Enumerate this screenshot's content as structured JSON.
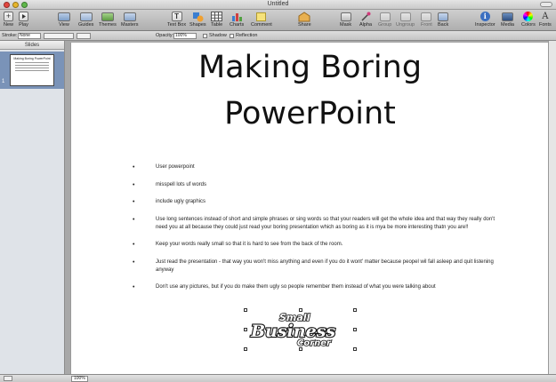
{
  "window": {
    "title": "Untitled"
  },
  "toolbar": {
    "new": "New",
    "play": "Play",
    "view": "View",
    "guides": "Guides",
    "themes": "Themes",
    "masters": "Masters",
    "text_box": "Text Box",
    "shapes": "Shapes",
    "table": "Table",
    "charts": "Charts",
    "comment": "Comment",
    "share": "Share",
    "mask": "Mask",
    "alpha": "Alpha",
    "group": "Group",
    "ungroup": "Ungroup",
    "front": "Front",
    "back": "Back",
    "inspector": "Inspector",
    "media": "Media",
    "colors": "Colors",
    "fonts": "Fonts"
  },
  "format_bar": {
    "stroke_label": "Stroke:",
    "stroke_value": "None",
    "opacity_label": "Opacity:",
    "opacity_value": "100%",
    "shadow_label": "Shadow",
    "reflection_label": "Reflection"
  },
  "sidebar": {
    "header": "Slides",
    "slides": [
      {
        "number": "1",
        "title": "Making Boring PowerPoint"
      }
    ]
  },
  "slide": {
    "title_line1": "Making Boring",
    "title_line2": "PowerPoint",
    "bullets": [
      "User powerpoint",
      "misspell lots uf words",
      "include ugly graphics",
      "Use long sentences instead of short and simple phrases or sing words so that your readers will get the whole idea and that way they really don't need you at all because they could just read your boring presentation which as boring as it is mya be more interesting thatn you are!!",
      "Keep your words really small so that it is hard to see from the back of the room.",
      "Just read the presentation - that way you won't miss anything and even if you do it wont' matter because peopel wil fall asleep and quit listening anyway",
      "Don't use any pictures, but if you do make them ugly so people remember them instead of what you were talking about"
    ],
    "logo": {
      "line1": "Small",
      "line2": "Business",
      "line3": "Corner"
    }
  },
  "status": {
    "zoom": "100%"
  },
  "colors": {
    "selection": "#7a93b8",
    "window_bg": "#a8a8a8"
  }
}
